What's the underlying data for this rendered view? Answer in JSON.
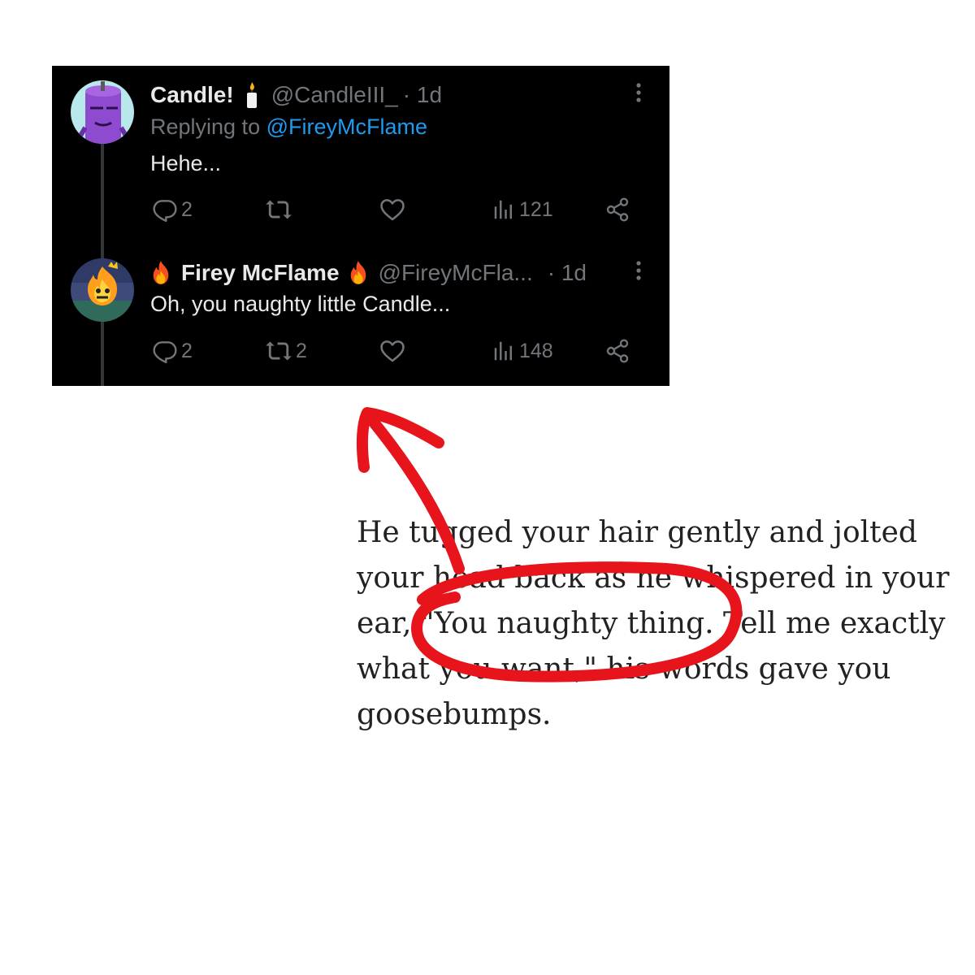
{
  "colors": {
    "panel_bg": "#000000",
    "name_text": "#e7e9ea",
    "meta_text": "#71767b",
    "link": "#1d9bf0",
    "annotation_red": "#e8141b",
    "story_text": "#222222"
  },
  "tweets": [
    {
      "display_name": "Candle!",
      "name_emoji": "candle-emoji",
      "handle": "@CandleIII_",
      "time": "· 1d",
      "replying_prefix": "Replying to",
      "replying_handle": "@FireyMcFlame",
      "text": "Hehe...",
      "reply_count": "2",
      "retweet_count": "",
      "like_count": "",
      "view_count": "121"
    },
    {
      "display_name": "Firey McFlame",
      "name_emoji": "fire-emoji",
      "handle": "@FireyMcFla...",
      "time": "· 1d",
      "text": "Oh, you naughty little Candle...",
      "reply_count": "2",
      "retweet_count": "2",
      "like_count": "",
      "view_count": "148"
    }
  ],
  "story": {
    "lines": [
      "He tugged your hair gently and jolted",
      "your head back as he whispered in your",
      "ear, \"You naughty thing. Tell me exactly",
      "what you want,\" his words gave you",
      "goosebumps."
    ]
  },
  "icons": [
    "more-vertical-icon",
    "reply-icon",
    "retweet-icon",
    "like-icon",
    "views-icon",
    "share-icon"
  ]
}
